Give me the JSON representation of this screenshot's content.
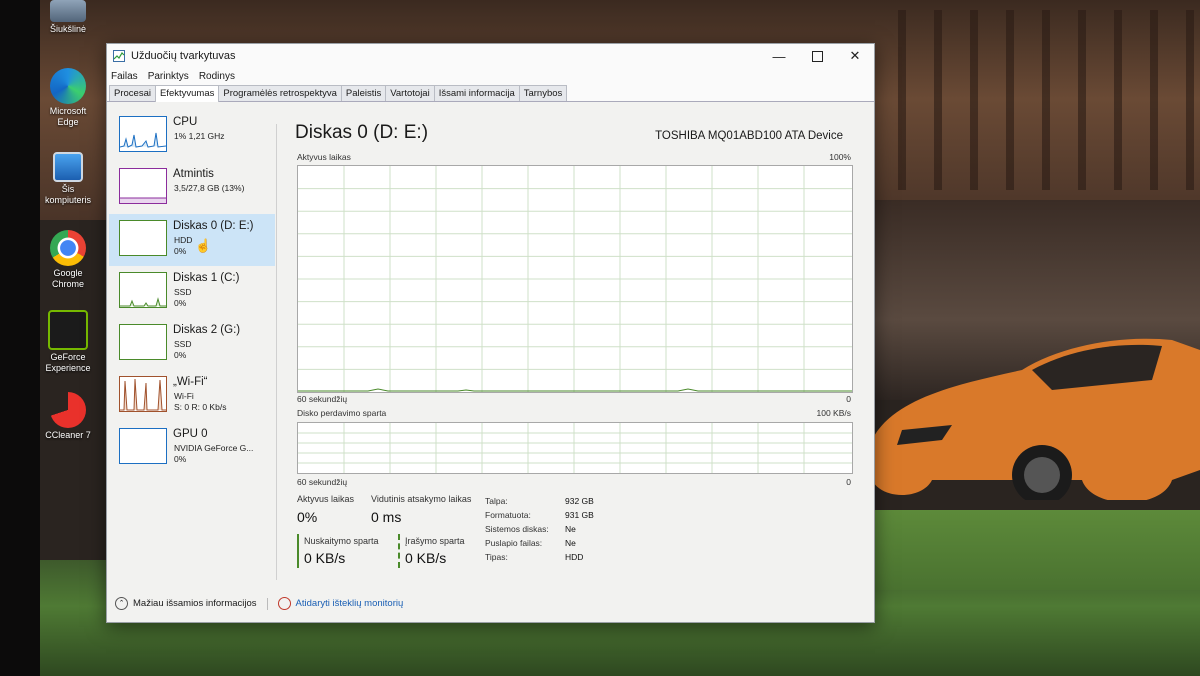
{
  "desktop": {
    "icons": [
      {
        "label": "Šiukšlinė",
        "icon": "recycle-bin-icon"
      },
      {
        "label": "Microsoft Edge",
        "icon": "edge-icon"
      },
      {
        "label": "Šis kompiuteris",
        "icon": "computer-icon"
      },
      {
        "label": "Google Chrome",
        "icon": "chrome-icon"
      },
      {
        "label": "GeForce Experience",
        "icon": "geforce-icon"
      },
      {
        "label": "CCleaner 7",
        "icon": "ccleaner-icon"
      }
    ]
  },
  "window": {
    "title": "Užduočių tvarkytuvas",
    "menu": [
      "Failas",
      "Parinktys",
      "Rodinys"
    ],
    "tabs": [
      "Procesai",
      "Efektyvumas",
      "Programėlės retrospektyva",
      "Paleistis",
      "Vartotojai",
      "Išsami informacija",
      "Tarnybos"
    ],
    "active_tab": "Efektyvumas"
  },
  "sidebar": [
    {
      "name": "CPU",
      "line1": "1% 1,21 GHz",
      "line2": ""
    },
    {
      "name": "Atmintis",
      "line1": "3,5/27,8 GB (13%)",
      "line2": ""
    },
    {
      "name": "Diskas 0 (D: E:)",
      "line1": "HDD",
      "line2": "0%"
    },
    {
      "name": "Diskas 1 (C:)",
      "line1": "SSD",
      "line2": "0%"
    },
    {
      "name": "Diskas 2 (G:)",
      "line1": "SSD",
      "line2": "0%"
    },
    {
      "name": "„Wi-Fi“",
      "line1": "Wi-Fi",
      "line2": "S: 0 R: 0 Kb/s"
    },
    {
      "name": "GPU 0",
      "line1": "NVIDIA GeForce G...",
      "line2": "0%"
    }
  ],
  "detail": {
    "title": "Diskas 0 (D: E:)",
    "device": "TOSHIBA MQ01ABD100 ATA Device",
    "graph1": {
      "label": "Aktyvus laikas",
      "max": "100%",
      "time": "60 sekundžių",
      "min": "0"
    },
    "graph2": {
      "label": "Disko perdavimo sparta",
      "max": "100 KB/s",
      "time": "60 sekundžių",
      "min": "0"
    },
    "stats": {
      "active_time_label": "Aktyvus laikas",
      "active_time": "0%",
      "response_label": "Vidutinis atsakymo laikas",
      "response": "0 ms",
      "read_label": "Nuskaitymo sparta",
      "read": "0 KB/s",
      "write_label": "Įrašymo sparta",
      "write": "0 KB/s"
    },
    "properties": [
      {
        "key": "Talpa:",
        "value": "932 GB"
      },
      {
        "key": "Formatuota:",
        "value": "931 GB"
      },
      {
        "key": "Sistemos diskas:",
        "value": "Ne"
      },
      {
        "key": "Puslapio failas:",
        "value": "Ne"
      },
      {
        "key": "Tipas:",
        "value": "HDD"
      }
    ]
  },
  "footer": {
    "less_details": "Mažiau išsamios informacijos",
    "open_monitor": "Atidaryti išteklių monitorių"
  }
}
